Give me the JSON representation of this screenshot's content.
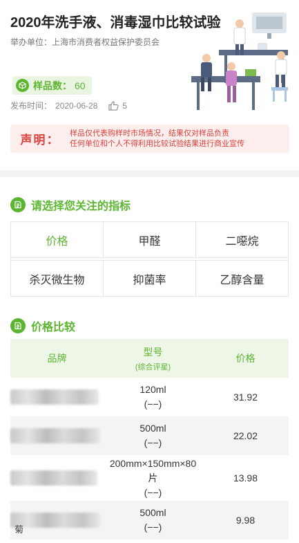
{
  "header": {
    "title": "2020年洗手液、消毒湿巾比较试验",
    "organizer": "举办单位：上海市消费者权益保护委员会",
    "sample_label": "样品数：",
    "sample_count": "60",
    "date_label": "发布时间：",
    "date": "2020-06-28",
    "likes": "5"
  },
  "notice": {
    "tag": "声明：",
    "line1": "样品仅代表购样时市场情况，结果仅对样品负责",
    "line2": "任何单位和个人不得利用比较试验结果进行商业宣传"
  },
  "indicator_section": {
    "title": "请选择您关注的指标",
    "options": [
      "价格",
      "甲醛",
      "二噁烷",
      "杀灭微生物",
      "抑菌率",
      "乙醇含量"
    ],
    "selected": "价格"
  },
  "price_section": {
    "title": "价格比较",
    "headers": {
      "brand": "品牌",
      "model": "型号",
      "model_sub": "(综合评星)",
      "price": "价格"
    },
    "rows": [
      {
        "model": "120ml",
        "rating": "(−−)",
        "price": "31.92",
        "brand_visible": ""
      },
      {
        "model": "500ml",
        "rating": "(−−)",
        "price": "22.02",
        "brand_visible": ""
      },
      {
        "model": "200mm×150mm×80片",
        "model_line1": "200mm×150mm×80",
        "model_line2": "片",
        "rating": "(−−)",
        "price": "13.98",
        "brand_visible": ""
      },
      {
        "model": "500ml",
        "rating": "(−−)",
        "price": "9.98",
        "brand_visible": "菊"
      }
    ]
  },
  "colors": {
    "accent": "#5cb531",
    "notice": "#d9413c",
    "notice_bg": "#fdeeee",
    "header_bg": "#eef6e8"
  }
}
